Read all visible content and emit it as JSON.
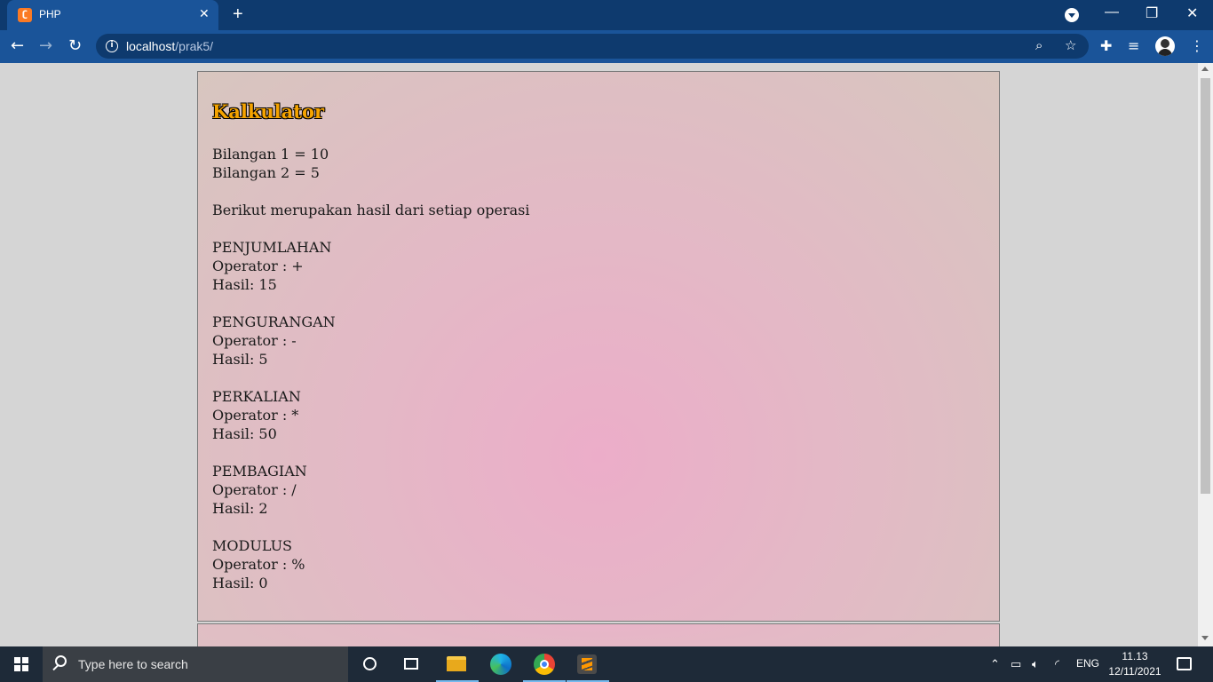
{
  "browser": {
    "tab_title": "PHP",
    "tab_close": "✕",
    "new_tab": "+",
    "url_host": "localhost",
    "url_path": "/prak5/",
    "window_controls": {
      "minimize": "—",
      "restore": "❐",
      "close": "✕"
    }
  },
  "page": {
    "heading": "Kalkulator",
    "bilangan1": "Bilangan 1 = 10",
    "bilangan2": "Bilangan 2 = 5",
    "intro": "Berikut merupakan hasil dari setiap operasi",
    "operations": [
      {
        "name": "PENJUMLAHAN",
        "operator": "Operator : +",
        "result": "Hasil: 15"
      },
      {
        "name": "PENGURANGAN",
        "operator": "Operator : -",
        "result": "Hasil: 5"
      },
      {
        "name": "PERKALIAN",
        "operator": "Operator : *",
        "result": "Hasil: 50"
      },
      {
        "name": "PEMBAGIAN",
        "operator": "Operator : /",
        "result": "Hasil: 2"
      },
      {
        "name": "MODULUS",
        "operator": "Operator : %",
        "result": "Hasil: 0"
      }
    ]
  },
  "taskbar": {
    "search_placeholder": "Type here to search",
    "language": "ENG",
    "time": "11.13",
    "date": "12/11/2021"
  },
  "icons": {
    "back": "back-arrow-icon",
    "forward": "forward-arrow-icon",
    "reload": "reload-icon",
    "info": "info-icon",
    "zoom": "zoom-icon",
    "star": "star-icon",
    "extensions": "puzzle-icon",
    "media": "media-queue-icon",
    "menu": "kebab-menu-icon"
  },
  "colors": {
    "chrome_frame": "#0e3a6e",
    "chrome_toolbar": "#1a5499",
    "heading_fill": "#f5a300",
    "taskbar": "#1e2a38"
  }
}
